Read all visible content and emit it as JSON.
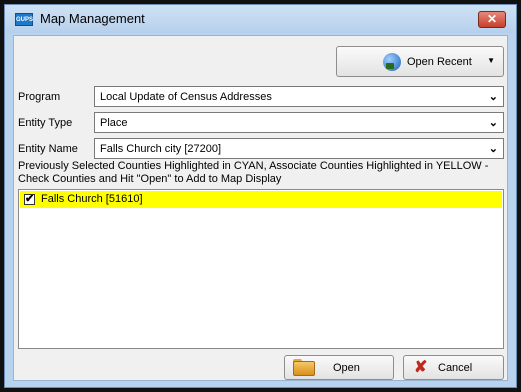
{
  "window": {
    "title": "Map Management",
    "app_icon_text": "GUPS",
    "close_glyph": "✕"
  },
  "toolbar": {
    "open_recent_label": "Open Recent",
    "dropdown_glyph": "▼"
  },
  "fields": {
    "program": {
      "label": "Program",
      "value": "Local Update of Census Addresses"
    },
    "entity_type": {
      "label": "Entity Type",
      "value": "Place"
    },
    "entity_name": {
      "label": "Entity Name",
      "value": "Falls Church city [27200]"
    },
    "combo_arrow": "⌄"
  },
  "instructions": "Previously Selected Counties Highlighted in CYAN, Associate Counties Highlighted in YELLOW - Check Counties and Hit \"Open\" to Add to Map Display",
  "counties": [
    {
      "label": "Falls Church [51610]",
      "checked": true,
      "highlight": "#ffff00"
    }
  ],
  "checkmark_glyph": "✔",
  "buttons": {
    "open_label": "Open",
    "cancel_label": "Cancel",
    "cancel_glyph": "✘"
  },
  "colors": {
    "frame_blue": "#b8d3ee",
    "yellow_highlight": "#ffff00",
    "close_red": "#c6402b"
  }
}
